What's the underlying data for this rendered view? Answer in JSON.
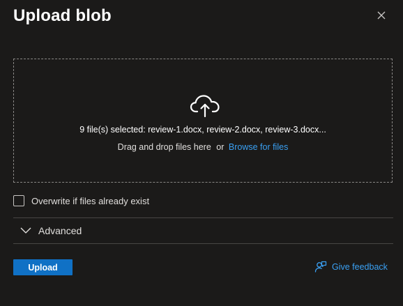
{
  "dialog": {
    "title": "Upload blob",
    "close_icon": "close-icon"
  },
  "dropzone": {
    "icon": "cloud-upload-icon",
    "selected_text": "9 file(s) selected: review-1.docx, review-2.docx, review-3.docx...",
    "drag_text": "Drag and drop files here",
    "or_text": "or",
    "browse_label": "Browse for files"
  },
  "options": {
    "overwrite_label": "Overwrite if files already exist",
    "overwrite_checked": false,
    "advanced_label": "Advanced",
    "advanced_icon": "chevron-down-icon"
  },
  "footer": {
    "upload_label": "Upload",
    "feedback_label": "Give feedback",
    "feedback_icon": "feedback-icon"
  },
  "colors": {
    "background": "#1b1a19",
    "accent": "#1071c5",
    "link": "#3aa0f3",
    "border": "#8a8886"
  }
}
